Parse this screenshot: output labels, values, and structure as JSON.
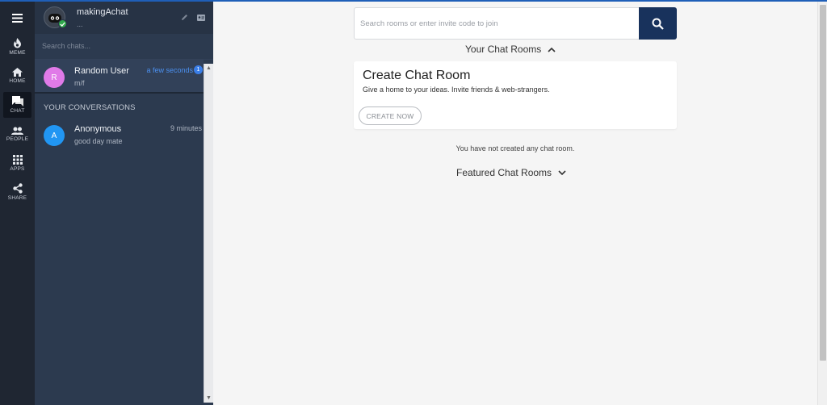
{
  "rail": {
    "items": [
      {
        "label": "MEME",
        "icon": "flame-icon"
      },
      {
        "label": "HOME",
        "icon": "home-icon"
      },
      {
        "label": "CHAT",
        "icon": "chat-icon",
        "active": true
      },
      {
        "label": "PEOPLE",
        "icon": "people-icon"
      },
      {
        "label": "APPS",
        "icon": "apps-grid-icon"
      },
      {
        "label": "SHARE",
        "icon": "share-icon"
      }
    ]
  },
  "panel": {
    "username": "makingAchat",
    "status": "...",
    "search_placeholder": "Search chats...",
    "section_label": "YOUR CONVERSATIONS",
    "pinned": {
      "initial": "R",
      "name": "Random User",
      "message": "m/f",
      "time": "a few seconds",
      "unread": "1",
      "avatar_color": "#e07ae8"
    },
    "conversations": [
      {
        "initial": "A",
        "name": "Anonymous",
        "message": "good day mate",
        "time": "9 minutes",
        "avatar_color": "#2196f3"
      }
    ]
  },
  "main": {
    "search_placeholder": "Search rooms or enter invite code to join",
    "your_rooms_title": "Your Chat Rooms",
    "create": {
      "title": "Create Chat Room",
      "subtitle": "Give a home to your ideas. Invite friends & web-strangers.",
      "button": "CREATE NOW"
    },
    "empty_note": "You have not created any chat room.",
    "featured_title": "Featured Chat Rooms"
  },
  "colors": {
    "rail_bg": "#1f2632",
    "panel_bg": "#2c3a4f",
    "accent_blue": "#18325c",
    "link_blue": "#4b90f0",
    "online_green": "#2ea84a"
  }
}
